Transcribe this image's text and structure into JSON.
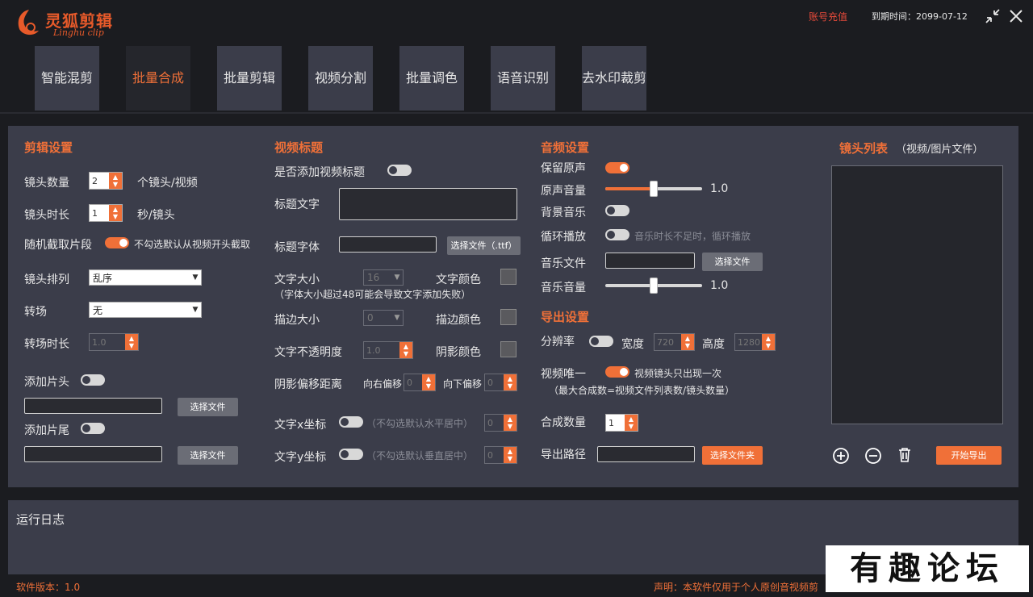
{
  "app": {
    "logo_title": "灵狐剪辑",
    "logo_subtitle": "Linghu clip",
    "recharge_label": "账号充值",
    "expire_label": "到期时间：2099-07-12",
    "accent": "#f07038"
  },
  "tabs": [
    {
      "label": "智能混剪",
      "active": false
    },
    {
      "label": "批量合成",
      "active": true
    },
    {
      "label": "批量剪辑",
      "active": false
    },
    {
      "label": "视频分割",
      "active": false
    },
    {
      "label": "批量调色",
      "active": false
    },
    {
      "label": "语音识别",
      "active": false
    },
    {
      "label": "去水印裁剪",
      "active": false
    }
  ],
  "clip": {
    "title": "剪辑设置",
    "shot_count_label": "镜头数量",
    "shot_count_value": "2",
    "shot_count_unit": "个镜头/视频",
    "shot_duration_label": "镜头时长",
    "shot_duration_value": "1",
    "shot_duration_unit": "秒/镜头",
    "random_label": "随机截取片段",
    "random_hint": "不勾选默认从视频开头截取",
    "order_label": "镜头排列",
    "order_value": "乱序",
    "transition_label": "转场",
    "transition_value": "无",
    "transition_dur_label": "转场时长",
    "transition_dur_value": "1.0",
    "intro_label": "添加片头",
    "outro_label": "添加片尾",
    "select_file": "选择文件"
  },
  "video_title": {
    "title": "视频标题",
    "add_label": "是否添加视频标题",
    "text_label": "标题文字",
    "font_label": "标题字体",
    "font_btn": "选择文件（.ttf）",
    "size_label": "文字大小",
    "size_value": "16",
    "size_hint": "（字体大小超过48可能会导致文字添加失败）",
    "color_label": "文字颜色",
    "stroke_label": "描边大小",
    "stroke_value": "0",
    "stroke_color_label": "描边颜色",
    "opacity_label": "文字不透明度",
    "opacity_value": "1.0",
    "shadow_color_label": "阴影颜色",
    "shadow_offset_label": "阴影偏移距离",
    "right_offset_label": "向右偏移",
    "right_offset_value": "0",
    "down_offset_label": "向下偏移",
    "down_offset_value": "0",
    "x_label": "文字x坐标",
    "x_hint": "（不勾选默认水平居中）",
    "x_value": "0",
    "y_label": "文字y坐标",
    "y_hint": "（不勾选默认垂直居中）",
    "y_value": "0"
  },
  "audio": {
    "title": "音频设置",
    "keep_label": "保留原声",
    "orig_vol_label": "原声音量",
    "orig_vol_value": "1.0",
    "orig_vol_fraction": 0.5,
    "bgm_label": "背景音乐",
    "loop_label": "循环播放",
    "loop_hint": "音乐时长不足时，循环播放",
    "music_file_label": "音乐文件",
    "select_file": "选择文件",
    "music_vol_label": "音乐音量",
    "music_vol_value": "1.0",
    "music_vol_fraction": 0.5
  },
  "export": {
    "title": "导出设置",
    "resolution_label": "分辨率",
    "width_label": "宽度",
    "width_value": "720",
    "height_label": "高度",
    "height_value": "1280",
    "unique_label": "视频唯一",
    "unique_hint": "视频镜头只出现一次",
    "max_hint": "（最大合成数=视频文件列表数/镜头数量）",
    "count_label": "合成数量",
    "count_value": "1",
    "path_label": "导出路径",
    "select_folder": "选择文件夹"
  },
  "shots": {
    "title": "镜头列表",
    "subtitle": "（视频/图片文件）",
    "start_export": "开始导出"
  },
  "log": {
    "title": "运行日志"
  },
  "footer": {
    "version": "软件版本：1.0",
    "disclaimer": "声明：本软件仅用于个人原创音视频剪"
  },
  "watermark": "有趣论坛"
}
